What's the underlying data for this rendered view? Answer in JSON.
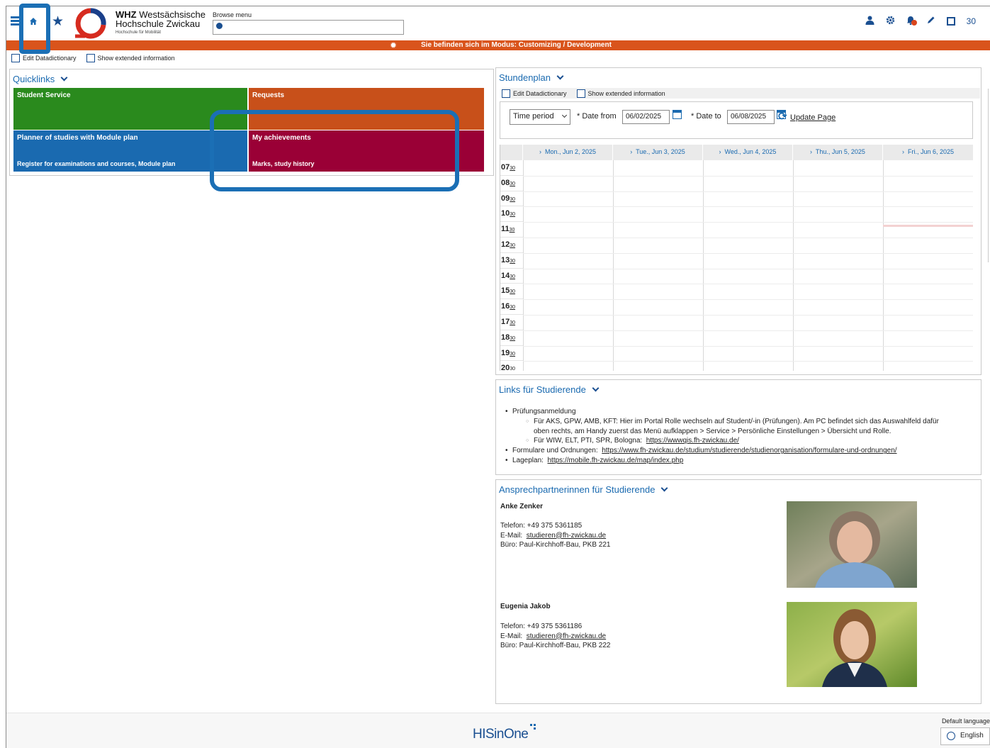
{
  "header": {
    "logo_bold": "WHZ",
    "logo_line1": "Westsächsische",
    "logo_line2": "Hochschule Zwickau",
    "logo_line3": "Hochschule für Mobilität",
    "browse_label": "Browse menu",
    "browse_placeholder": "",
    "counter": "30"
  },
  "mode_bar": {
    "text": "Sie befinden sich im Modus: Customizing / Development"
  },
  "top_checks": {
    "edit_datadictionary": "Edit Datadictionary",
    "show_extended": "Show extended information"
  },
  "quicklinks": {
    "title": "Quicklinks",
    "tiles": [
      {
        "title": "Student Service",
        "sub": "",
        "color": "#2a8a1d"
      },
      {
        "title": "Requests",
        "sub": "",
        "color": "#c8501a"
      },
      {
        "title": "Planner of studies with Module plan",
        "sub": "Register for examinations and courses, Module plan",
        "color": "#1a6ab0"
      },
      {
        "title": "My achievements",
        "sub": "Marks, study history",
        "color": "#9a0036"
      }
    ]
  },
  "schedule": {
    "title": "Stundenplan",
    "edit_datadictionary": "Edit Datadictionary",
    "show_extended": "Show extended information",
    "period_select": "Time period",
    "date_from_label": "* Date from",
    "date_from": "06/02/2025",
    "date_to_label": "* Date to",
    "date_to": "06/08/2025",
    "update_label": "Update Page",
    "days": [
      "Mon., Jun 2, 2025",
      "Tue., Jun 3, 2025",
      "Wed., Jun 4, 2025",
      "Thu., Jun 5, 2025",
      "Fri., Jun 6, 2025"
    ],
    "hours": [
      {
        "h": "07",
        "m": "30"
      },
      {
        "h": "08",
        "m": "30"
      },
      {
        "h": "09",
        "m": "30"
      },
      {
        "h": "10",
        "m": "30"
      },
      {
        "h": "11",
        "m": "30"
      },
      {
        "h": "12",
        "m": "30"
      },
      {
        "h": "13",
        "m": "30"
      },
      {
        "h": "14",
        "m": "30"
      },
      {
        "h": "15",
        "m": "30"
      },
      {
        "h": "16",
        "m": "30"
      },
      {
        "h": "17",
        "m": "30"
      },
      {
        "h": "18",
        "m": "30"
      },
      {
        "h": "19",
        "m": "30"
      },
      {
        "h": "20",
        "m": "30"
      }
    ]
  },
  "links": {
    "title": "Links für Studierende",
    "item1": "Prüfungsanmeldung",
    "item1_sub1a": "Für AKS, GPW, AMB, KFT: Hier im Portal Rolle wechseln auf Student/-in (Prüfungen). Am PC befindet sich das Auswahlfeld dafür",
    "item1_sub1b": "oben rechts, am Handy zuerst das Menü aufklappen > Service > Persönliche Einstellungen > Übersicht und Rolle.",
    "item1_sub2": "Für WIW, ELT, PTI, SPR, Bologna:",
    "item1_sub2_link": "https://wwwqis.fh-zwickau.de/",
    "item2": "Formulare und Ordnungen:",
    "item2_link": "https://www.fh-zwickau.de/studium/studierende/studienorganisation/formulare-und-ordnungen/",
    "item3": "Lageplan:",
    "item3_link": "https://mobile.fh-zwickau.de/map/index.php"
  },
  "contacts": {
    "title": "Ansprechpartnerinnen für Studierende",
    "people": [
      {
        "name": "Anke Zenker",
        "phone": "Telefon: +49 375 5361185",
        "email_label": "E-Mail:",
        "email": "studieren@fh-zwickau.de",
        "office": "Büro: Paul-Kirchhoff-Bau, PKB 221"
      },
      {
        "name": "Eugenia Jakob",
        "phone": "Telefon: +49 375 5361186",
        "email_label": "E-Mail:",
        "email": "studieren@fh-zwickau.de",
        "office": "Büro: Paul-Kirchhoff-Bau, PKB 222"
      }
    ]
  },
  "footer": {
    "brand": "HISinOne",
    "default_language": "Default language",
    "language": "English"
  }
}
